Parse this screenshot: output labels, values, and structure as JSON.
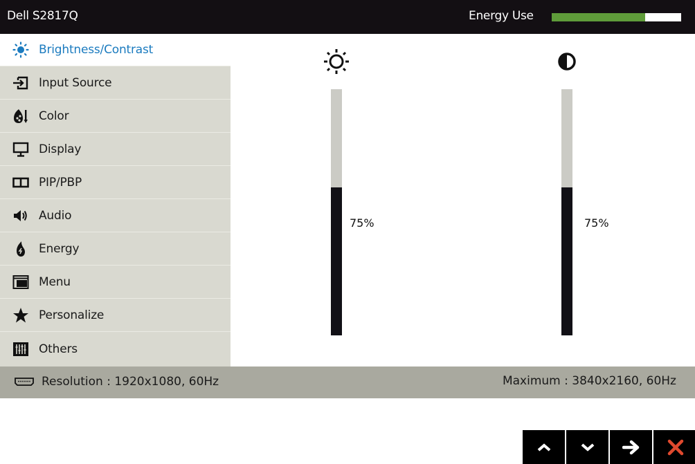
{
  "header": {
    "title": "Dell S2817Q",
    "energy_label": "Energy Use",
    "energy_use_fraction": 0.72,
    "energy_color": "#5f9c3a"
  },
  "sidebar": {
    "accent_color": "#1b7bbf",
    "items": [
      {
        "label": "Brightness/Contrast",
        "icon": "brightness-icon",
        "active": true
      },
      {
        "label": "Input Source",
        "icon": "input-source-icon",
        "active": false
      },
      {
        "label": "Color",
        "icon": "color-icon",
        "active": false
      },
      {
        "label": "Display",
        "icon": "display-icon",
        "active": false
      },
      {
        "label": "PIP/PBP",
        "icon": "pip-pbp-icon",
        "active": false
      },
      {
        "label": "Audio",
        "icon": "audio-icon",
        "active": false
      },
      {
        "label": "Energy",
        "icon": "energy-icon",
        "active": false
      },
      {
        "label": "Menu",
        "icon": "menu-icon",
        "active": false
      },
      {
        "label": "Personalize",
        "icon": "star-icon",
        "active": false
      },
      {
        "label": "Others",
        "icon": "others-icon",
        "active": false
      }
    ]
  },
  "sliders": {
    "brightness": {
      "icon": "sun-icon",
      "value": 75,
      "label": "75%"
    },
    "contrast": {
      "icon": "contrast-icon",
      "value": 75,
      "label": "75%"
    }
  },
  "status": {
    "resolution": "Resolution : 1920x1080, 60Hz",
    "maximum": "Maximum : 3840x2160, 60Hz"
  },
  "nav_buttons": [
    {
      "name": "up",
      "icon": "chevron-up-icon"
    },
    {
      "name": "down",
      "icon": "chevron-down-icon"
    },
    {
      "name": "enter",
      "icon": "arrow-right-icon"
    },
    {
      "name": "exit",
      "icon": "close-icon",
      "color": "#e0492e"
    }
  ]
}
